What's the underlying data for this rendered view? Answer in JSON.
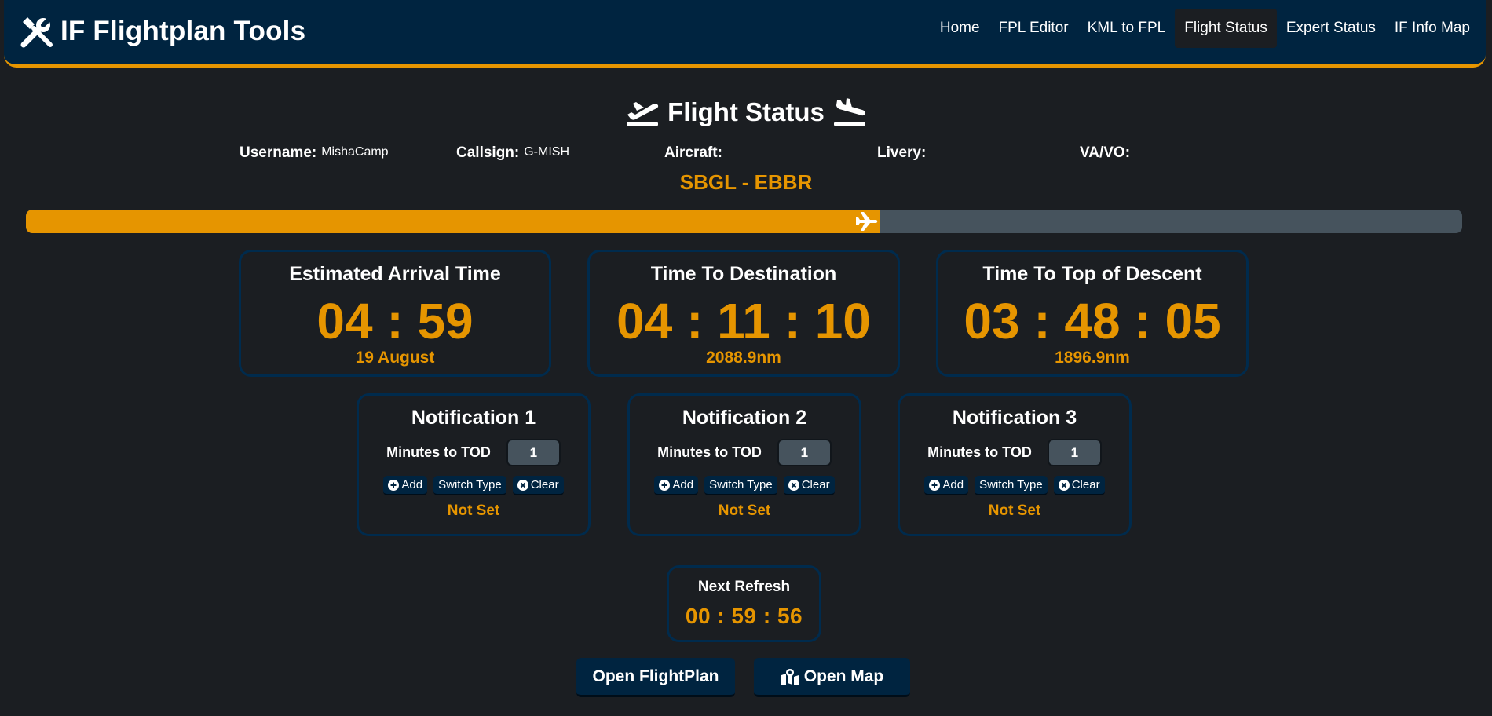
{
  "header": {
    "brand_icon": "tools-icon",
    "brand_title": "IF Flightplan Tools",
    "nav": [
      {
        "label": "Home",
        "active": false
      },
      {
        "label": "FPL Editor",
        "active": false
      },
      {
        "label": "KML to FPL",
        "active": false
      },
      {
        "label": "Flight Status",
        "active": true
      },
      {
        "label": "Expert Status",
        "active": false
      },
      {
        "label": "IF Info Map",
        "active": false
      }
    ]
  },
  "page": {
    "title": "Flight Status",
    "title_icons": [
      "plane-departure-icon",
      "plane-arrival-icon"
    ]
  },
  "info": {
    "username_label": "Username:",
    "username_value": "MishaCamp",
    "callsign_label": "Callsign:",
    "callsign_value": "G-MISH",
    "aircraft_label": "Aircraft:",
    "aircraft_value": "",
    "livery_label": "Livery:",
    "livery_value": "",
    "vavo_label": "VA/VO:",
    "vavo_value": ""
  },
  "route": "SBGL - EBBR",
  "progress": {
    "fraction": 0.595,
    "icon": "plane-icon"
  },
  "stats": [
    {
      "title": "Estimated Arrival Time",
      "value": "04 : 59",
      "sub": "19 August"
    },
    {
      "title": "Time To Destination",
      "value": "04 : 11 : 10",
      "sub": "2088.9nm"
    },
    {
      "title": "Time To Top of Descent",
      "value": "03 : 48 : 05",
      "sub": "1896.9nm"
    }
  ],
  "notifications": [
    {
      "title": "Notification 1",
      "label": "Minutes to TOD",
      "value": "1",
      "add": "Add",
      "switch": "Switch Type",
      "clear": "Clear",
      "status": "Not Set"
    },
    {
      "title": "Notification 2",
      "label": "Minutes to TOD",
      "value": "1",
      "add": "Add",
      "switch": "Switch Type",
      "clear": "Clear",
      "status": "Not Set"
    },
    {
      "title": "Notification 3",
      "label": "Minutes to TOD",
      "value": "1",
      "add": "Add",
      "switch": "Switch Type",
      "clear": "Clear",
      "status": "Not Set"
    }
  ],
  "refresh": {
    "title": "Next Refresh",
    "value": "00 : 59 : 56"
  },
  "actions": {
    "open_flightplan": "Open FlightPlan",
    "open_map": "Open Map",
    "open_map_icon": "map-marked-icon"
  },
  "colors": {
    "accent": "#e69500",
    "header_bg": "#002440",
    "page_bg": "#1b1e22",
    "progress_track": "#46535d",
    "card_border": "#002b4d"
  }
}
